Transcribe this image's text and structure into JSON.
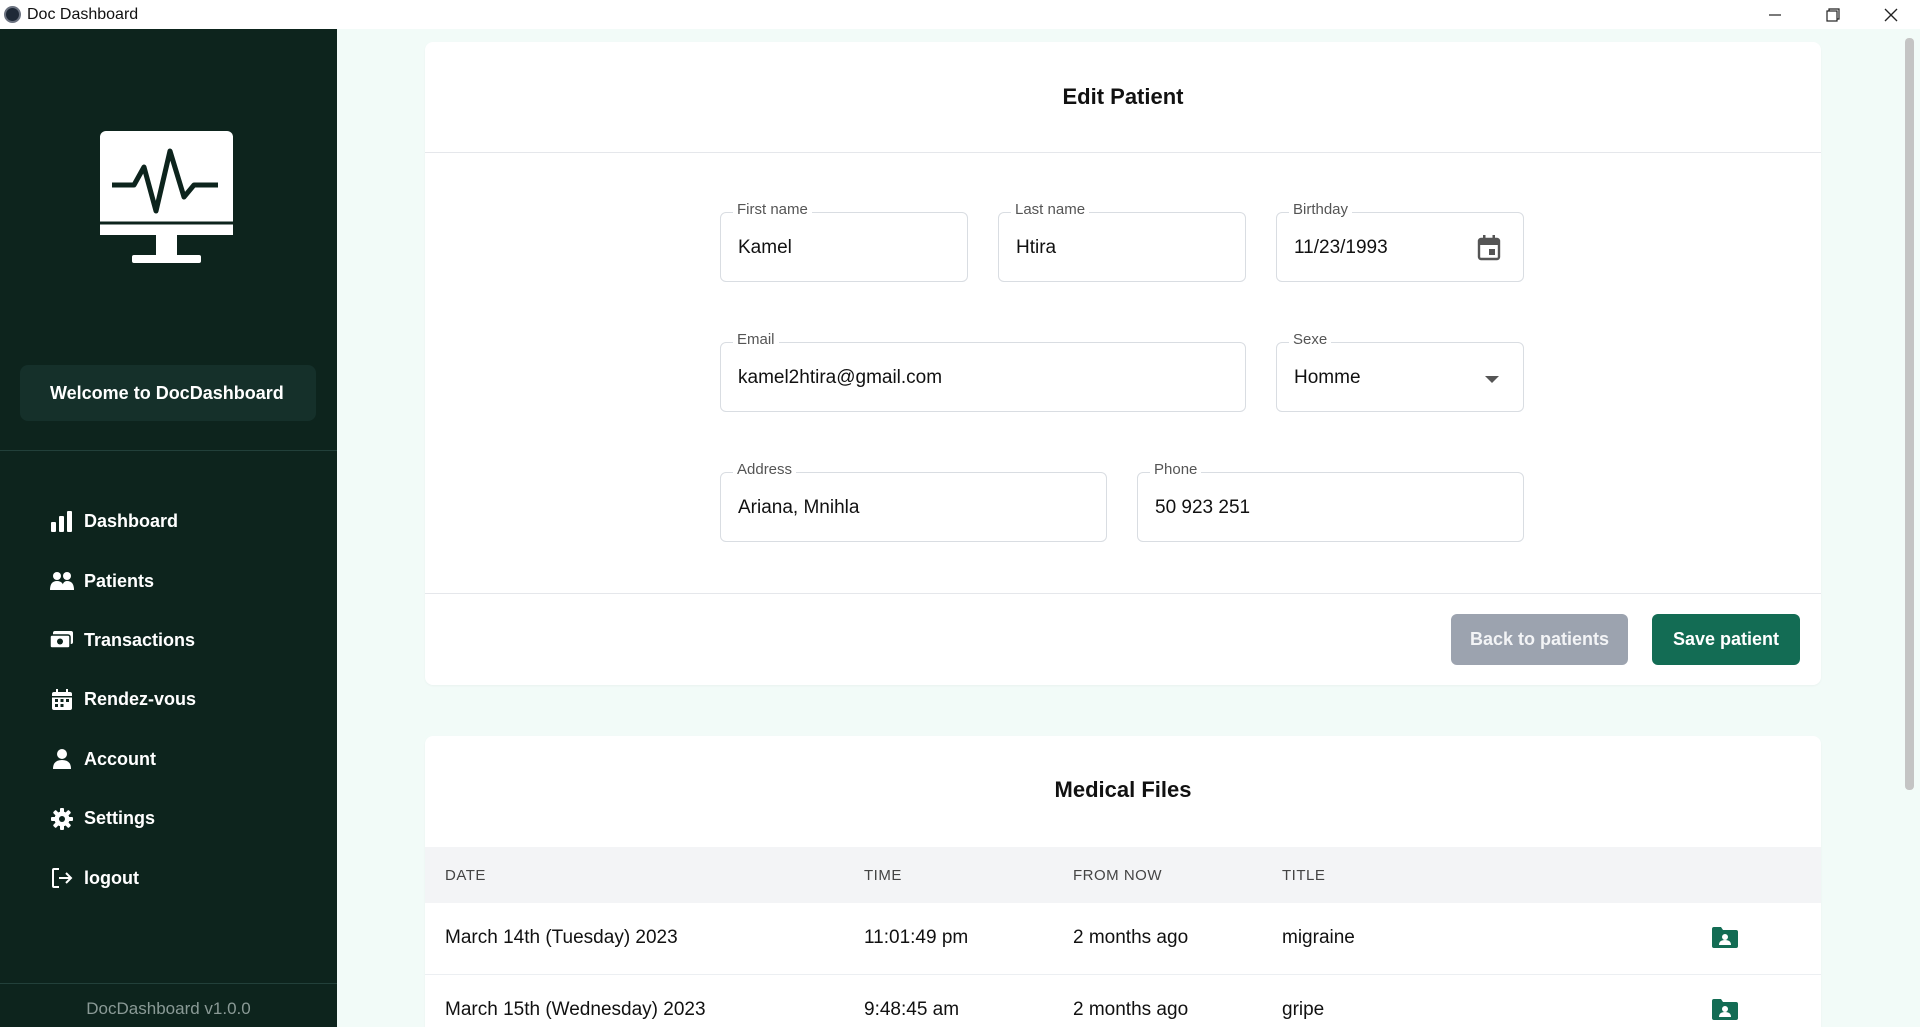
{
  "window": {
    "title": "Doc Dashboard",
    "controls": {
      "minimize": "—",
      "maximize": "❐",
      "close": "✕"
    }
  },
  "sidebar": {
    "logo_icon": "monitor-heartbeat-icon",
    "welcome": "Welcome to DocDashboard",
    "items": [
      {
        "label": "Dashboard",
        "icon": "bar-chart-icon"
      },
      {
        "label": "Patients",
        "icon": "users-icon"
      },
      {
        "label": "Transactions",
        "icon": "money-icon"
      },
      {
        "label": "Rendez-vous",
        "icon": "calendar-icon"
      },
      {
        "label": "Account",
        "icon": "user-icon"
      },
      {
        "label": "Settings",
        "icon": "gear-icon"
      },
      {
        "label": "logout",
        "icon": "logout-icon"
      }
    ],
    "version": "DocDashboard v1.0.0"
  },
  "edit": {
    "title": "Edit Patient",
    "first_name": {
      "label": "First name",
      "value": "Kamel"
    },
    "last_name": {
      "label": "Last name",
      "value": "Htira"
    },
    "birthday": {
      "label": "Birthday",
      "value": "11/23/1993"
    },
    "email": {
      "label": "Email",
      "value": "kamel2htira@gmail.com"
    },
    "sexe": {
      "label": "Sexe",
      "value": "Homme"
    },
    "address": {
      "label": "Address",
      "value": "Ariana, Mnihla"
    },
    "phone": {
      "label": "Phone",
      "value": "50 923 251"
    },
    "back_label": "Back to patients",
    "save_label": "Save patient"
  },
  "files": {
    "title": "Medical Files",
    "columns": [
      "DATE",
      "TIME",
      "FROM NOW",
      "TITLE"
    ],
    "rows": [
      {
        "date": "March 14th (Tuesday) 2023",
        "time": "11:01:49 pm",
        "from_now": "2 months ago",
        "title": "migraine"
      },
      {
        "date": "March 15th (Wednesday) 2023",
        "time": "9:48:45 am",
        "from_now": "2 months ago",
        "title": "gripe"
      }
    ]
  },
  "colors": {
    "sidebar_bg": "#0d241d",
    "accent": "#136c54",
    "page_bg": "#f2fbf8"
  }
}
